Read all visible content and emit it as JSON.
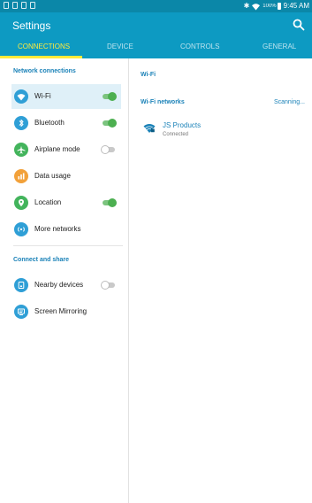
{
  "status_bar": {
    "left_icons": [
      "notification-icon",
      "notification-icon",
      "notification-icon",
      "image-icon"
    ],
    "bluetooth_icon": "bluetooth-icon",
    "wifi_icon": "wifi-icon",
    "battery_percent": "100%",
    "time": "9:45 AM"
  },
  "header": {
    "title": "Settings",
    "search_icon": "search-icon",
    "tabs": [
      {
        "label": "CONNECTIONS",
        "active": true
      },
      {
        "label": "DEVICE",
        "active": false
      },
      {
        "label": "CONTROLS",
        "active": false
      },
      {
        "label": "GENERAL",
        "active": false
      }
    ]
  },
  "sidebar": {
    "sections": [
      {
        "title": "Network connections",
        "items": [
          {
            "label": "Wi-Fi",
            "icon": "wifi-icon",
            "color": "#2f9fd6",
            "toggle": "on",
            "selected": true
          },
          {
            "label": "Bluetooth",
            "icon": "bluetooth-icon",
            "color": "#2f9fd6",
            "toggle": "on"
          },
          {
            "label": "Airplane mode",
            "icon": "airplane-icon",
            "color": "#43b45c",
            "toggle": "off"
          },
          {
            "label": "Data usage",
            "icon": "chart-icon",
            "color": "#f2a13a"
          },
          {
            "label": "Location",
            "icon": "location-pin-icon",
            "color": "#43b45c",
            "toggle": "on"
          },
          {
            "label": "More networks",
            "icon": "more-networks-icon",
            "color": "#2f9fd6"
          }
        ]
      },
      {
        "title": "Connect and share",
        "items": [
          {
            "label": "Nearby devices",
            "icon": "nearby-devices-icon",
            "color": "#2f9fd6",
            "toggle": "off"
          },
          {
            "label": "Screen Mirroring",
            "icon": "screen-mirroring-icon",
            "color": "#2f9fd6"
          }
        ]
      }
    ]
  },
  "main": {
    "title": "Wi-Fi",
    "networks_header": "Wi-Fi networks",
    "scan_status": "Scanning...",
    "networks": [
      {
        "name": "JS Products",
        "status": "Connected",
        "icon": "wifi-secured-icon"
      }
    ]
  },
  "colors": {
    "status_bar": "#0b87a8",
    "header": "#0d9ac2",
    "active_tab": "#ffeb3b",
    "accent": "#1b82b8",
    "toggle_on": "#4caf50"
  }
}
